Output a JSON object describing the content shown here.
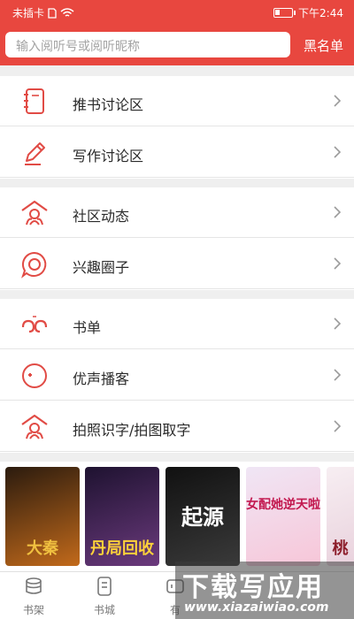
{
  "status": {
    "carrier": "未插卡",
    "time": "下午2:44",
    "battery_level": 0.3
  },
  "search": {
    "placeholder": "输入阅听号或阅听昵称"
  },
  "header": {
    "blacklist_label": "黑名单"
  },
  "menu": {
    "book_discussion": "推书讨论区",
    "writing_discussion": "写作讨论区",
    "community_news": "社区动态",
    "interest_circle": "兴趣圈子",
    "book_list": "书单",
    "voice_podcast": "优声播客",
    "photo_ocr": "拍照识字/拍图取字"
  },
  "covers": [
    {
      "title": "大秦",
      "colors": [
        "#2b1b0e",
        "#c26a1b"
      ]
    },
    {
      "title": "丹局回收",
      "colors": [
        "#1e1230",
        "#6b3a7d"
      ]
    },
    {
      "title": "起源",
      "colors": [
        "#111111",
        "#3a3a3a"
      ]
    },
    {
      "title": "女配她逆天啦",
      "colors": [
        "#f0e6f5",
        "#f7c6d8"
      ]
    },
    {
      "title": "桃",
      "colors": [
        "#f7eef2",
        "#e9d2dd"
      ]
    }
  ],
  "nav": {
    "shelf": "书架",
    "store": "书城",
    "have": "有"
  },
  "watermark": {
    "brand": "下载写应用",
    "domain": "www.xiazaiwiao.com"
  },
  "colors": {
    "brand": "#e8473f",
    "icon_red": "#e14b45"
  }
}
